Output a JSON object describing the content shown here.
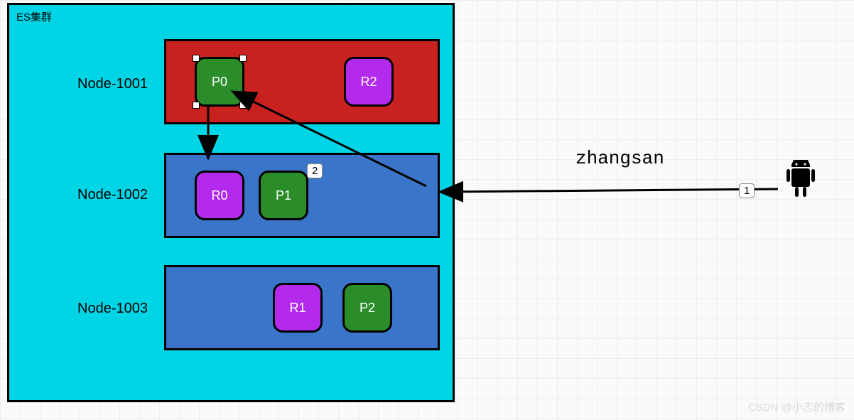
{
  "cluster": {
    "title": "ES集群"
  },
  "nodes": {
    "n1": {
      "label": "Node-1001",
      "shards": {
        "p": "P0",
        "r": "R2"
      }
    },
    "n2": {
      "label": "Node-1002",
      "shards": {
        "r": "R0",
        "p": "P1"
      }
    },
    "n3": {
      "label": "Node-1003",
      "shards": {
        "r": "R1",
        "p": "P2"
      }
    }
  },
  "client": {
    "label": "zhangsan"
  },
  "arrows": {
    "step1": "1",
    "step2": "2"
  },
  "watermark": "CSDN @小志的博客"
}
